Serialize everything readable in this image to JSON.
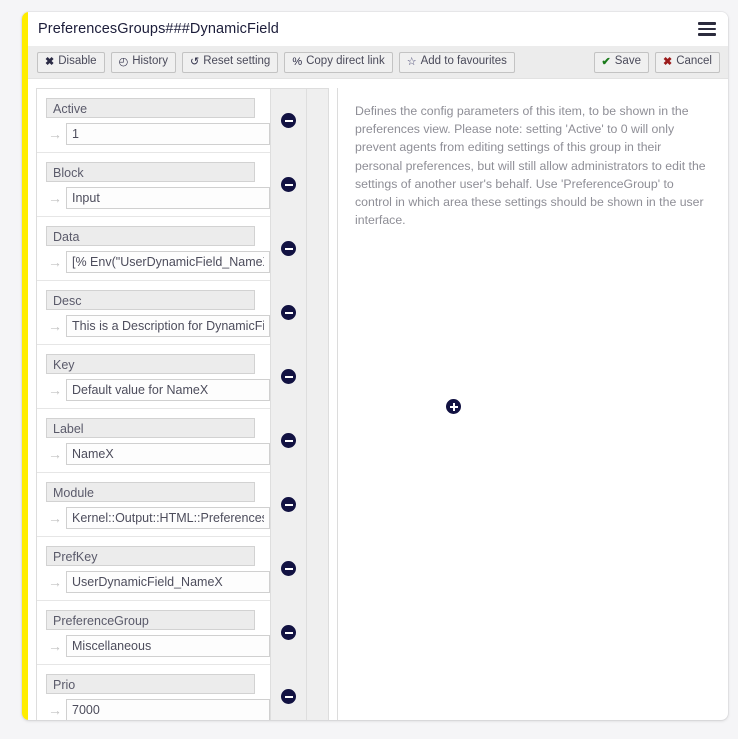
{
  "header": {
    "title": "PreferencesGroups###DynamicField",
    "menu_icon": "hamburger-icon"
  },
  "toolbar": {
    "left_buttons": [
      {
        "label": "Disable",
        "icon": "x-icon",
        "glyph": "✖",
        "glyph_class": "gl-x"
      },
      {
        "label": "History",
        "icon": "clock-icon",
        "glyph": "◴",
        "glyph_class": "gl-clock"
      },
      {
        "label": "Reset setting",
        "icon": "reset-icon",
        "glyph": "↺",
        "glyph_class": "gl-reset"
      },
      {
        "label": "Copy direct link",
        "icon": "link-icon",
        "glyph": "%",
        "glyph_class": "gl-link"
      },
      {
        "label": "Add to favourites",
        "icon": "star-outline-icon",
        "glyph": "☆",
        "glyph_class": "gl-star"
      }
    ],
    "right_buttons": [
      {
        "label": "Save",
        "icon": "check-icon",
        "glyph": "✔",
        "glyph_class": "gl-check"
      },
      {
        "label": "Cancel",
        "icon": "x-icon",
        "glyph": "✖",
        "glyph_class": "gl-cancel"
      }
    ]
  },
  "form": {
    "arrow_glyph": "→",
    "remove_icon": "remove-circle-icon",
    "add_icon": "add-circle-icon",
    "rows": [
      {
        "label": "Active",
        "value": "1"
      },
      {
        "label": "Block",
        "value": "Input"
      },
      {
        "label": "Data",
        "value": "[% Env(\"UserDynamicField_NameX\") %]"
      },
      {
        "label": "Desc",
        "value": "This is a Description for DynamicField in Preference."
      },
      {
        "label": "Key",
        "value": "Default value for NameX"
      },
      {
        "label": "Label",
        "value": "NameX"
      },
      {
        "label": "Module",
        "value": "Kernel::Output::HTML::Preferences::Generic"
      },
      {
        "label": "PrefKey",
        "value": "UserDynamicField_NameX"
      },
      {
        "label": "PreferenceGroup",
        "value": "Miscellaneous"
      },
      {
        "label": "Prio",
        "value": "7000"
      }
    ]
  },
  "description": {
    "text": "Defines the config parameters of this item, to be shown in the preferences view. Please note: setting 'Active' to 0 will only prevent agents from editing settings of this group in their personal preferences, but will still allow administrators to edit the settings of another user's behalf. Use 'PreferenceGroup' to control in which area these settings should be shown in the user interface."
  },
  "colors": {
    "modified_stripe": "#ffed00",
    "icon_navy": "#121242",
    "save_check": "#1a7a1a",
    "cancel_x": "#9b1b1b",
    "toolbar_bg": "#ececec"
  }
}
